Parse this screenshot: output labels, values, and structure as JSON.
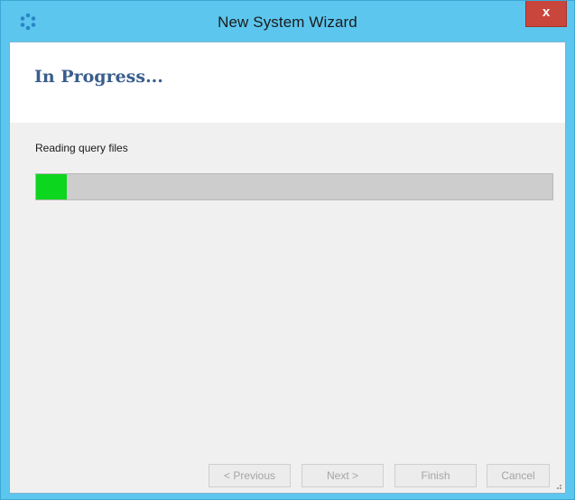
{
  "window": {
    "title": "New System Wizard",
    "close_label": "x",
    "icon": "wizard-app-icon"
  },
  "page": {
    "heading": "In Progress..."
  },
  "progress": {
    "status_text": "Reading query files",
    "fraction": 0.06,
    "fill_color": "#0dd61f"
  },
  "buttons": {
    "previous": "< Previous",
    "next": "Next >",
    "finish": "Finish",
    "cancel": "Cancel"
  },
  "colors": {
    "titlebar": "#5cc6ee",
    "close_button": "#c9463d",
    "heading": "#3a5e8c"
  }
}
